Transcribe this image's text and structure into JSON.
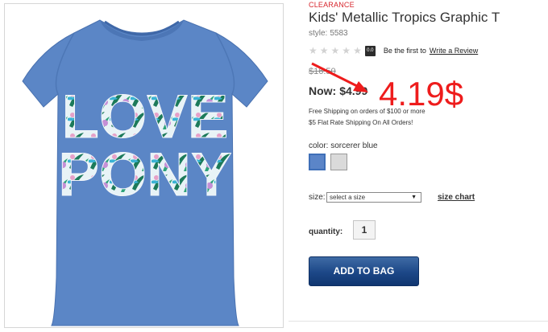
{
  "product": {
    "badge": "CLEARANCE",
    "title": "Kids' Metallic Tropics Graphic T",
    "style_label": "style:",
    "style_number": "5583",
    "rating": {
      "stars_total": 5,
      "stars_filled": 0,
      "badge": "0.0",
      "first_text": "Be the first to",
      "review_link": "Write a Review"
    },
    "price": {
      "old": "$16.50",
      "now_label": "Now:",
      "now_value": "$4.99"
    },
    "shipping": {
      "line1": "Free Shipping on orders of $100 or more",
      "line2": "$5 Flat Rate Shipping On All Orders!"
    },
    "color": {
      "label": "color:",
      "selected": "sorcerer blue",
      "swatches": [
        {
          "name": "sorcerer blue",
          "hex": "#5b85c8"
        },
        {
          "name": "grey",
          "hex": "#dadada"
        }
      ]
    },
    "size": {
      "label": "size:",
      "selected": "select a size",
      "chart_link": "size chart"
    },
    "quantity": {
      "label": "quantity:",
      "value": "1"
    },
    "add_to_bag": "ADD TO BAG",
    "image": {
      "shirt_color": "#5b86c6",
      "graphic_text_line1": "LOVE",
      "graphic_text_line2": "PONY"
    }
  },
  "annotation": {
    "price_text": "4.19$",
    "color": "#ee1c1c"
  }
}
